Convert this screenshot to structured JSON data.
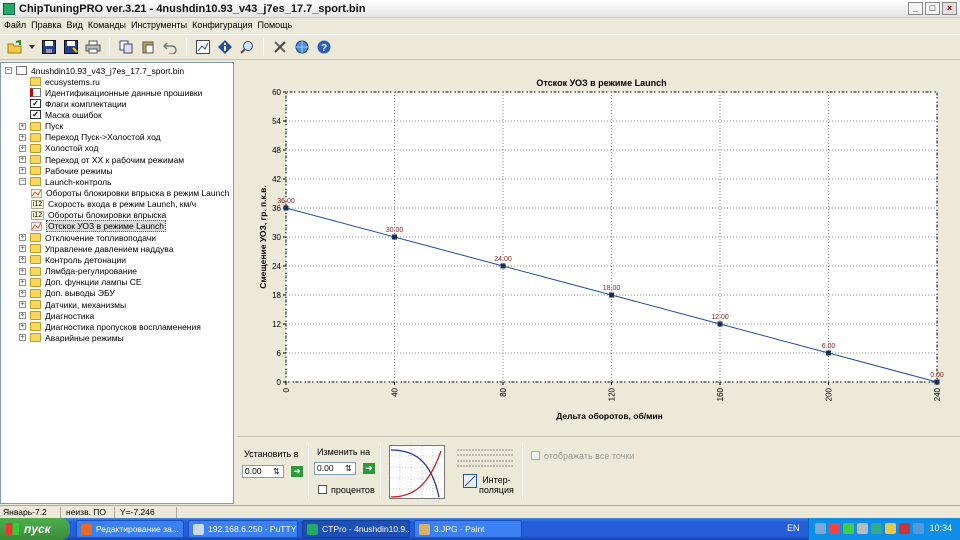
{
  "window": {
    "title": "ChipTuningPRO ver.3.21 - 4nushdin10.93_v43_j7es_17.7_sport.bin",
    "controls": [
      "_",
      "□",
      "×"
    ]
  },
  "menu": [
    "Файл",
    "Правка",
    "Вид",
    "Команды",
    "Инструменты",
    "Конфигурация",
    "Помощь"
  ],
  "toolbar": [
    "open-icon",
    "dropdown-icon",
    "save-icon",
    "save-as-icon",
    "print-icon",
    "copy-icon",
    "paste-icon",
    "undo-icon",
    "chart-view-icon",
    "info-icon",
    "search-icon",
    "tools-icon",
    "network-icon",
    "help-icon"
  ],
  "tree": {
    "root": "4nushdin10.93_v43_j7es_17.7_sport.bin",
    "items": [
      {
        "label": "ecusystems.ru",
        "icon": "folder",
        "exp": false,
        "level": 1
      },
      {
        "label": "Идентификационные данные прошивки",
        "icon": "doc-red",
        "exp": false,
        "level": 1
      },
      {
        "label": "Флаги комплектации",
        "icon": "check",
        "exp": false,
        "level": 1
      },
      {
        "label": "Маска ошибок",
        "icon": "check",
        "exp": false,
        "level": 1
      },
      {
        "label": "Пуск",
        "icon": "folder",
        "exp": true,
        "level": 1
      },
      {
        "label": "Переход Пуск->Холостой ход",
        "icon": "folder",
        "exp": true,
        "level": 1
      },
      {
        "label": "Холостой ход",
        "icon": "folder",
        "exp": true,
        "level": 1
      },
      {
        "label": "Переход от ХХ к рабочим режимам",
        "icon": "folder",
        "exp": true,
        "level": 1
      },
      {
        "label": "Рабочие режимы",
        "icon": "folder",
        "exp": true,
        "level": 1
      },
      {
        "label": "Launch-контроль",
        "icon": "folder",
        "exp": true,
        "expanded": true,
        "level": 1
      },
      {
        "label": "Обороты блокировки впрыска в режим Launch",
        "icon": "chart",
        "exp": false,
        "level": 2
      },
      {
        "label": "Скорость входа в режим Launch, км/ч",
        "icon": "i12",
        "exp": false,
        "level": 2
      },
      {
        "label": "Обороты блокировки впрыска",
        "icon": "i12",
        "exp": false,
        "level": 2
      },
      {
        "label": "Отскок УОЗ в режиме Launch",
        "icon": "chart",
        "exp": false,
        "level": 2,
        "selected": true
      },
      {
        "label": "Отключение топливоподачи",
        "icon": "folder",
        "exp": true,
        "level": 1
      },
      {
        "label": "Управление давлением наддува",
        "icon": "folder",
        "exp": true,
        "level": 1
      },
      {
        "label": "Контроль детонации",
        "icon": "folder",
        "exp": true,
        "level": 1
      },
      {
        "label": "Лямбда-регулирование",
        "icon": "folder",
        "exp": true,
        "level": 1
      },
      {
        "label": "Доп. функции лампы CE",
        "icon": "folder",
        "exp": true,
        "level": 1
      },
      {
        "label": "Доп. выводы ЭБУ",
        "icon": "folder",
        "exp": true,
        "level": 1
      },
      {
        "label": "Датчики, механизмы",
        "icon": "folder",
        "exp": true,
        "level": 1
      },
      {
        "label": "Диагностика",
        "icon": "folder",
        "exp": true,
        "level": 1
      },
      {
        "label": "Диагностика пропусков воспламенения",
        "icon": "folder",
        "exp": true,
        "level": 1
      },
      {
        "label": "Аварийные режимы",
        "icon": "folder",
        "exp": true,
        "level": 1
      }
    ]
  },
  "chart_data": {
    "type": "line",
    "title": "Отскок УОЗ в режиме Launch",
    "xlabel": "Дельта оборотов, об/мин",
    "ylabel": "Смещение УОЗ, гр. п.к.в.",
    "x": [
      0,
      40,
      80,
      120,
      160,
      200,
      240
    ],
    "values": [
      36,
      30,
      24,
      18,
      12,
      6,
      0
    ],
    "point_labels": [
      "36.00",
      "30.00",
      "24.00",
      "18.00",
      "12.00",
      "6.00",
      "0.00"
    ],
    "xticks": [
      "0",
      "40",
      "80",
      "120",
      "160",
      "200",
      "240"
    ],
    "yticks": [
      "0",
      "6",
      "12",
      "18",
      "24",
      "30",
      "36",
      "42",
      "48",
      "54",
      "60"
    ],
    "xlim": [
      0,
      240
    ],
    "ylim": [
      0,
      60
    ],
    "grid": true,
    "line_color": "#1f4f9a",
    "label_color": "#8b1a1a"
  },
  "controls": {
    "set_label": "Установить в",
    "set_value": "0.00",
    "change_label": "Изменить на",
    "change_value": "0.00",
    "percent_label": "процентов",
    "interp_label_1": "Интер-",
    "interp_label_2": "поляция",
    "show_all_points": "отображать все точки"
  },
  "status": {
    "month": "Январь-7.2",
    "po": "неизв. ПО",
    "y": "Y=-7.246"
  },
  "taskbar": {
    "start": "пуск",
    "tasks": [
      {
        "label": "Редактирование за...",
        "color": "#e86b1f"
      },
      {
        "label": "192.168.6.250 - PuTTY",
        "color": "#cfd8e6"
      },
      {
        "label": "CTPro - 4nushdin10.9...",
        "color": "#2a6"
      },
      {
        "label": "3.JPG - Paint",
        "color": "#d9b26a"
      }
    ],
    "lang": "EN",
    "time": "10:34"
  }
}
